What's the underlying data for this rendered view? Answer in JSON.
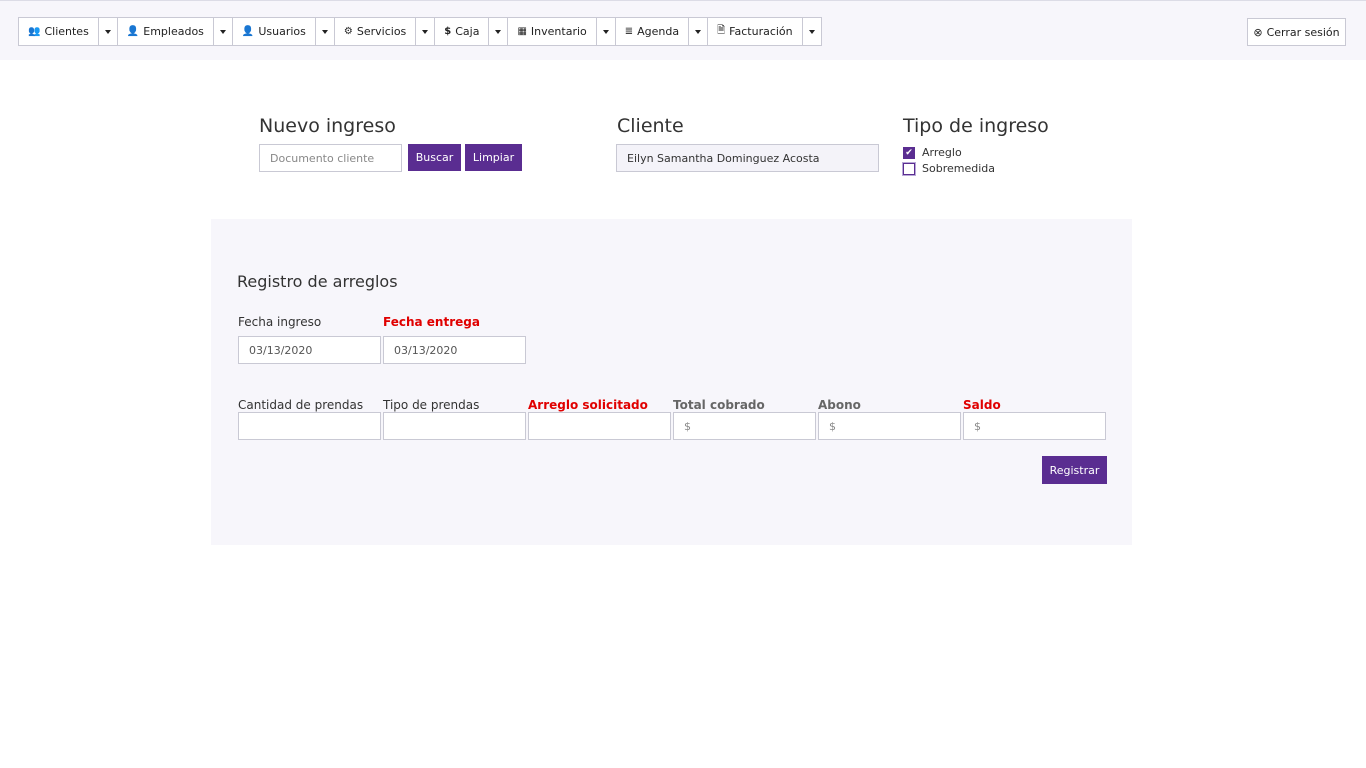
{
  "nav": {
    "items": [
      {
        "icon": "users-icon",
        "glyph": "👥",
        "label": "Clientes"
      },
      {
        "icon": "user-icon",
        "glyph": "👤",
        "label": "Empleados"
      },
      {
        "icon": "user-lock-icon",
        "glyph": "👤",
        "label": "Usuarios"
      },
      {
        "icon": "cogs-icon",
        "glyph": "⚙",
        "label": "Servicios"
      },
      {
        "icon": "dollar-icon",
        "glyph": "$",
        "label": "Caja"
      },
      {
        "icon": "boxes-icon",
        "glyph": "▦",
        "label": "Inventario"
      },
      {
        "icon": "list-icon",
        "glyph": "≣",
        "label": "Agenda"
      },
      {
        "icon": "invoice-icon",
        "glyph": "🗎",
        "label": "Facturación"
      }
    ],
    "logout_label": "Cerrar sesión",
    "logout_glyph": "⊗"
  },
  "ingreso": {
    "title": "Nuevo ingreso",
    "doc_placeholder": "Documento cliente",
    "search_label": "Buscar",
    "clear_label": "Limpiar"
  },
  "cliente": {
    "title": "Cliente",
    "name": "Eilyn Samantha Dominguez Acosta"
  },
  "tipo": {
    "title": "Tipo de ingreso",
    "options": [
      {
        "label": "Arreglo",
        "checked": true
      },
      {
        "label": "Sobremedida",
        "checked": false
      }
    ]
  },
  "registro": {
    "title": "Registro de arreglos",
    "fecha_ingreso_label": "Fecha ingreso",
    "fecha_ingreso_value": "03/13/2020",
    "fecha_entrega_label": "Fecha entrega",
    "fecha_entrega_value": "03/13/2020",
    "cantidad_label": "Cantidad de prendas",
    "tipo_prendas_label": "Tipo de prendas",
    "arreglo_label": "Arreglo solicitado",
    "total_label": "Total cobrado",
    "total_placeholder": "$",
    "abono_label": "Abono",
    "abono_placeholder": "$",
    "saldo_label": "Saldo",
    "saldo_placeholder": "$",
    "submit_label": "Registrar"
  },
  "colors": {
    "accent": "#5a2d91",
    "required": "#e00000",
    "panel_bg": "#f7f6fb"
  }
}
